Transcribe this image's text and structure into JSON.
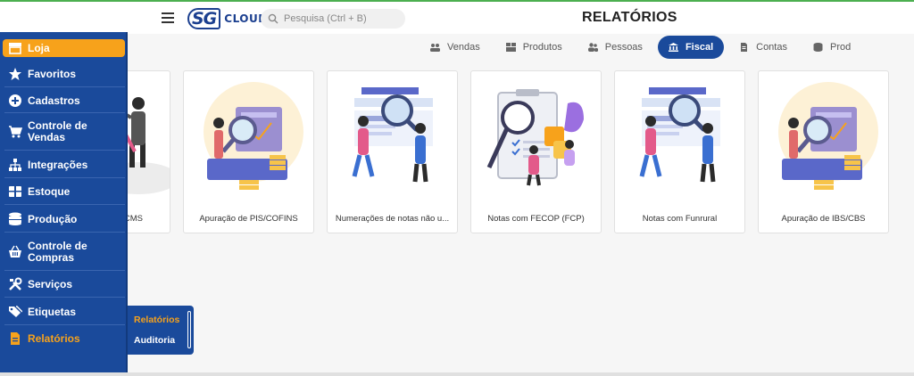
{
  "header": {
    "logo_sg": "SG",
    "logo_cloud": "CLOUD",
    "search_placeholder": "Pesquisa (Ctrl + B)",
    "page_title": "RELATÓRIOS"
  },
  "tabs": [
    {
      "label": "Vendas",
      "icon": "people-group-icon",
      "active": false
    },
    {
      "label": "Produtos",
      "icon": "boxes-icon",
      "active": false
    },
    {
      "label": "Pessoas",
      "icon": "users-icon",
      "active": false
    },
    {
      "label": "Fiscal",
      "icon": "bank-icon",
      "active": true
    },
    {
      "label": "Contas",
      "icon": "file-icon",
      "active": false
    },
    {
      "label": "Prod",
      "icon": "database-icon",
      "active": false
    }
  ],
  "cards": [
    {
      "label": "CMS"
    },
    {
      "label": "Apuração de PIS/COFINS"
    },
    {
      "label": "Numerações de notas não u..."
    },
    {
      "label": "Notas com FECOP (FCP)"
    },
    {
      "label": "Notas com Funrural"
    },
    {
      "label": "Apuração de IBS/CBS"
    }
  ],
  "sidebar": {
    "items": [
      {
        "label": "Loja",
        "icon": "store-icon"
      },
      {
        "label": "Favoritos",
        "icon": "star-icon"
      },
      {
        "label": "Cadastros",
        "icon": "plus-circle-icon"
      },
      {
        "label": "Controle de Vendas",
        "icon": "cart-icon"
      },
      {
        "label": "Integrações",
        "icon": "network-icon"
      },
      {
        "label": "Estoque",
        "icon": "warehouse-icon"
      },
      {
        "label": "Produção",
        "icon": "database-icon"
      },
      {
        "label": "Controle de Compras",
        "icon": "basket-icon"
      },
      {
        "label": "Serviços",
        "icon": "tools-icon"
      },
      {
        "label": "Etiquetas",
        "icon": "tags-icon"
      },
      {
        "label": "Relatórios",
        "icon": "report-icon"
      }
    ]
  },
  "submenu": {
    "items": [
      {
        "label": "Relatórios",
        "active": true
      },
      {
        "label": "Auditoria",
        "active": false
      }
    ]
  },
  "colors": {
    "primary": "#1a4a9b",
    "accent": "#f7a21b",
    "background": "#f6f6f6"
  }
}
